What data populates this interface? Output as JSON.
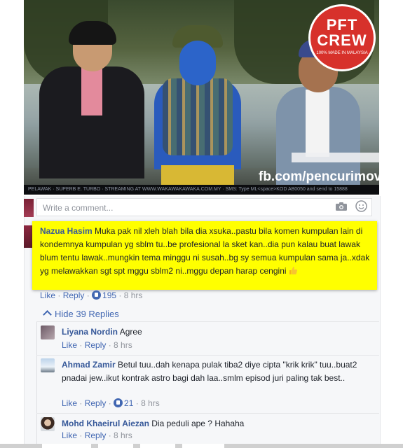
{
  "video": {
    "badge_line1": "PFT",
    "badge_line2": "CREW",
    "badge_tagline": "100% MADE IN MALAYSIA",
    "watermark": "fb.com/pencurimov",
    "ticker": "PELAWAK · SUPERB E. TURBO · STREAMING AT WWW.WAKAWAKAWAKA.COM.MY · SMS: Type ML<space>KOD AB0050 and send to 15888"
  },
  "comment_box": {
    "placeholder": "Write a comment...",
    "icons": [
      "camera-icon",
      "emoji-icon"
    ]
  },
  "main_comment": {
    "author": "Nazua Hasim",
    "text": "Muka pak nil xleh blah bila dia xsuka..pastu bila komen kumpulan lain di kondemnya kumpulan yg sblm tu..be profesional la sket kan..dia pun kalau buat lawak blum tentu lawak..mungkin tema minggu ni susah..bg sy semua kumpulan sama ja..xdak yg melawakkan sgt spt mggu sblm2 ni..mggu depan harap cengini",
    "emoji": "thumbs-up-icon",
    "highlight_color": "#ffff00",
    "like_label": "Like",
    "reply_label": "Reply",
    "likes": "195",
    "time": "8 hrs"
  },
  "hide_replies_label": "Hide 39 Replies",
  "replies": [
    {
      "author": "Liyana Nordin",
      "text": "Agree",
      "like_label": "Like",
      "reply_label": "Reply",
      "likes": "",
      "time": "8 hrs"
    },
    {
      "author": "Ahmad Zamir",
      "text": "Betul tuu..dah kenapa pulak tiba2 diye cipta \"krik krik\" tuu..buat2 pnadai jew..ikut kontrak astro bagi dah laa..smlm episod juri paling tak best..",
      "like_label": "Like",
      "reply_label": "Reply",
      "likes": "21",
      "time": "8 hrs"
    },
    {
      "author": "Mohd Khaeirul Aiezan",
      "text": "Dia peduli ape ? Hahaha",
      "like_label": "Like",
      "reply_label": "Reply",
      "likes": "",
      "time": "8 hrs"
    }
  ],
  "colors": {
    "link": "#4267b2",
    "author": "#365899",
    "meta": "#90949c",
    "badge_red": "#d7312b"
  }
}
